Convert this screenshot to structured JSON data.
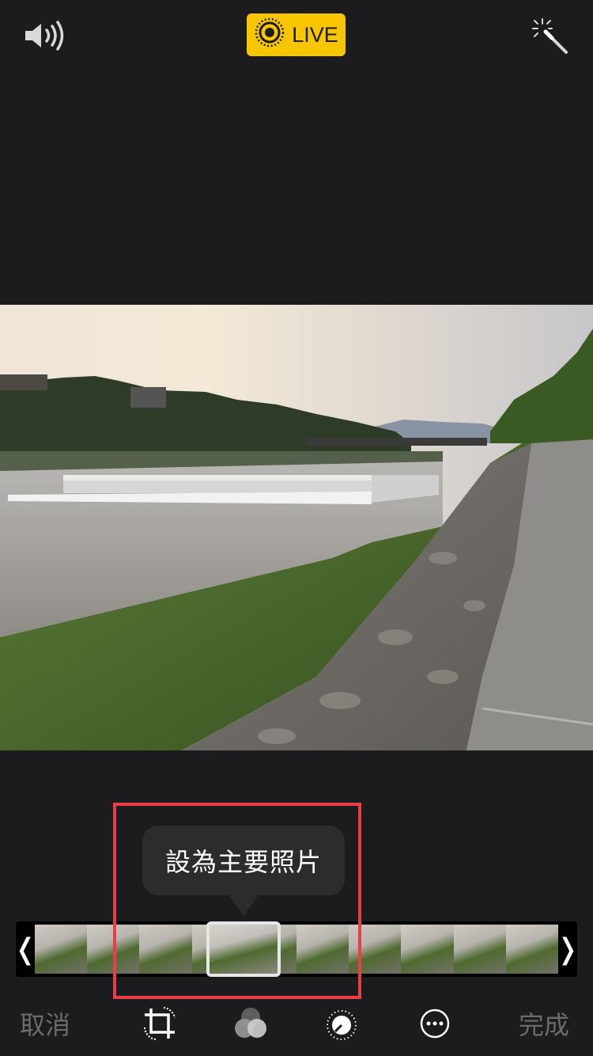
{
  "header": {
    "live_label": "LIVE",
    "icons": {
      "sound": "speaker-icon",
      "live": "live-photo-icon",
      "auto_enhance": "magic-wand-icon"
    }
  },
  "popover": {
    "label": "設為主要照片"
  },
  "scrubber": {
    "left_handle": "❬",
    "right_handle": "❭"
  },
  "toolbar": {
    "cancel_label": "取消",
    "done_label": "完成",
    "tools": [
      "crop-rotate-icon",
      "filters-icon",
      "adjust-dial-icon",
      "more-icon"
    ]
  },
  "colors": {
    "live_badge": "#f7c600",
    "highlight_box": "#ea3d46",
    "background": "#1c1c1e",
    "inactive_text": "#6b6b6e"
  }
}
